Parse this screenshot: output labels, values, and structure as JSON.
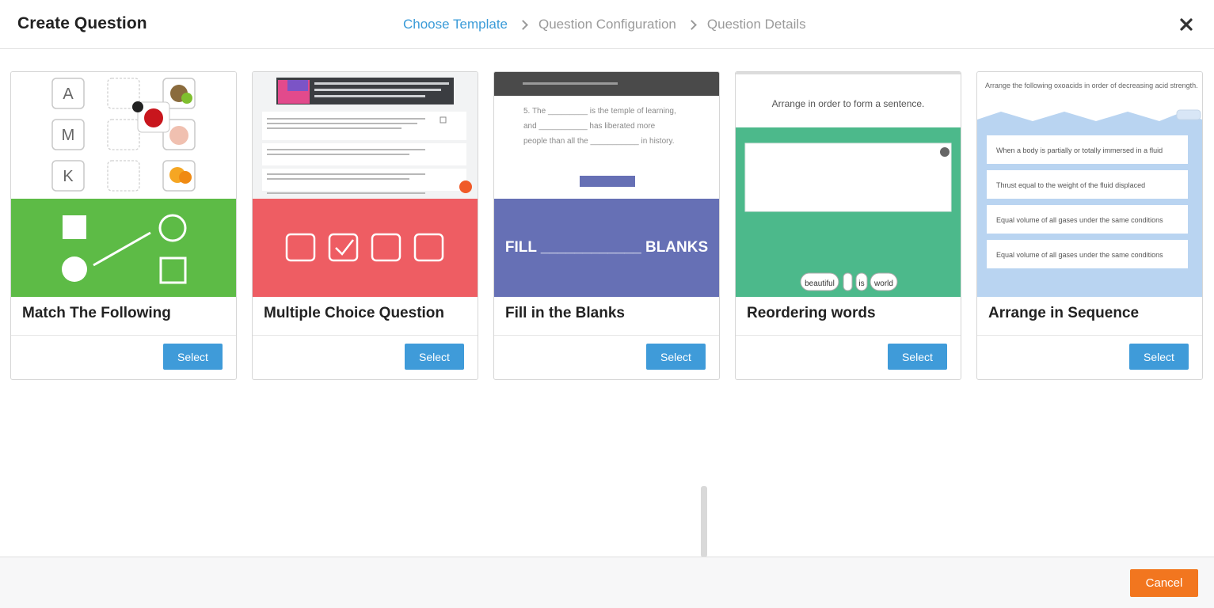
{
  "header": {
    "title": "Create Question",
    "steps": [
      "Choose Template",
      "Question Configuration",
      "Question Details"
    ],
    "active_step": 0,
    "close_icon": "close-icon"
  },
  "templates": [
    {
      "label": "Match The Following",
      "select_label": "Select",
      "accent": "#5dbb46"
    },
    {
      "label": "Multiple Choice Question",
      "select_label": "Select",
      "accent": "#ee5d63"
    },
    {
      "label": "Fill in the Blanks",
      "select_label": "Select",
      "accent": "#6670b5",
      "preview_text": "FILL ____________ BLANKS",
      "preview_sentence": [
        "5. The _________ is the temple of learning,",
        "and ___________ has liberated more",
        "people than all the ___________ in history."
      ]
    },
    {
      "label": "Reordering words",
      "select_label": "Select",
      "accent": "#4cb98b",
      "preview_title": "Arrange in order to form a sentence.",
      "preview_words": [
        "beautiful",
        "is",
        "world"
      ]
    },
    {
      "label": "Arrange in Sequence",
      "select_label": "Select",
      "accent": "#b9d4f1",
      "preview_title": "Arrange the following oxoacids in order of decreasing acid strength.",
      "preview_items": [
        "When a body is partially or totally immersed in a fluid",
        "Thrust equal to the weight of the fluid displaced",
        "Equal volume of all gases under the same conditions",
        "Equal volume of all gases under the same conditions"
      ]
    }
  ],
  "match_preview_letters": [
    "A",
    "M",
    "K"
  ],
  "footer": {
    "cancel_label": "Cancel"
  },
  "colors": {
    "primary": "#3f9bd9",
    "cancel": "#f2761f",
    "active_step": "#3a9bd8"
  }
}
